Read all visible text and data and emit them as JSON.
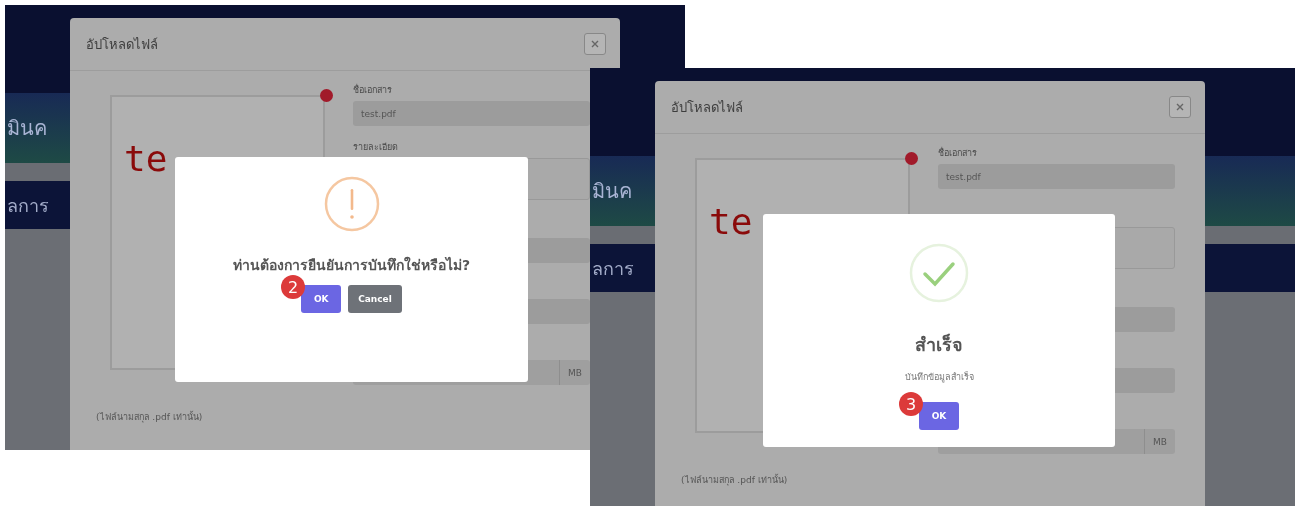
{
  "screenshots": [
    {
      "step": "2",
      "page": {
        "heading": "มินค",
        "section": "ลการ"
      },
      "upload_modal": {
        "title": "อัปโหลดไฟล์",
        "preview_text": "te",
        "note": "(ไฟล์นามสกุล .pdf เท่านั้น)",
        "fields": [
          {
            "kind": "input",
            "label": "ชื่อเอกสาร",
            "value": "test.pdf"
          },
          {
            "kind": "textarea",
            "label": "รายละเอียด"
          },
          {
            "kind": "input"
          },
          {
            "kind": "input"
          },
          {
            "kind": "unit",
            "unit": "MB"
          }
        ]
      },
      "alert": {
        "kind": "warning",
        "title": "ท่านต้องการยืนยันการบันทึกใช่หรือไม่?",
        "buttons": [
          {
            "kind": "confirm",
            "label": "OK"
          },
          {
            "kind": "cancel",
            "label": "Cancel"
          }
        ]
      }
    },
    {
      "step": "3",
      "page": {
        "heading": "มินค",
        "section": "ลการ"
      },
      "upload_modal": {
        "title": "อัปโหลดไฟล์",
        "preview_text": "te",
        "note": "(ไฟล์นามสกุล .pdf เท่านั้น)",
        "fields": [
          {
            "kind": "input",
            "label": "ชื่อเอกสาร",
            "value": "test.pdf"
          },
          {
            "kind": "textarea"
          },
          {
            "kind": "input"
          },
          {
            "kind": "input"
          },
          {
            "kind": "unit",
            "unit": "MB"
          }
        ]
      },
      "alert": {
        "kind": "success",
        "title": "สำเร็จ",
        "message": "บันทึกข้อมูลสำเร็จ",
        "buttons": [
          {
            "kind": "confirm",
            "label": "OK"
          }
        ]
      }
    }
  ]
}
